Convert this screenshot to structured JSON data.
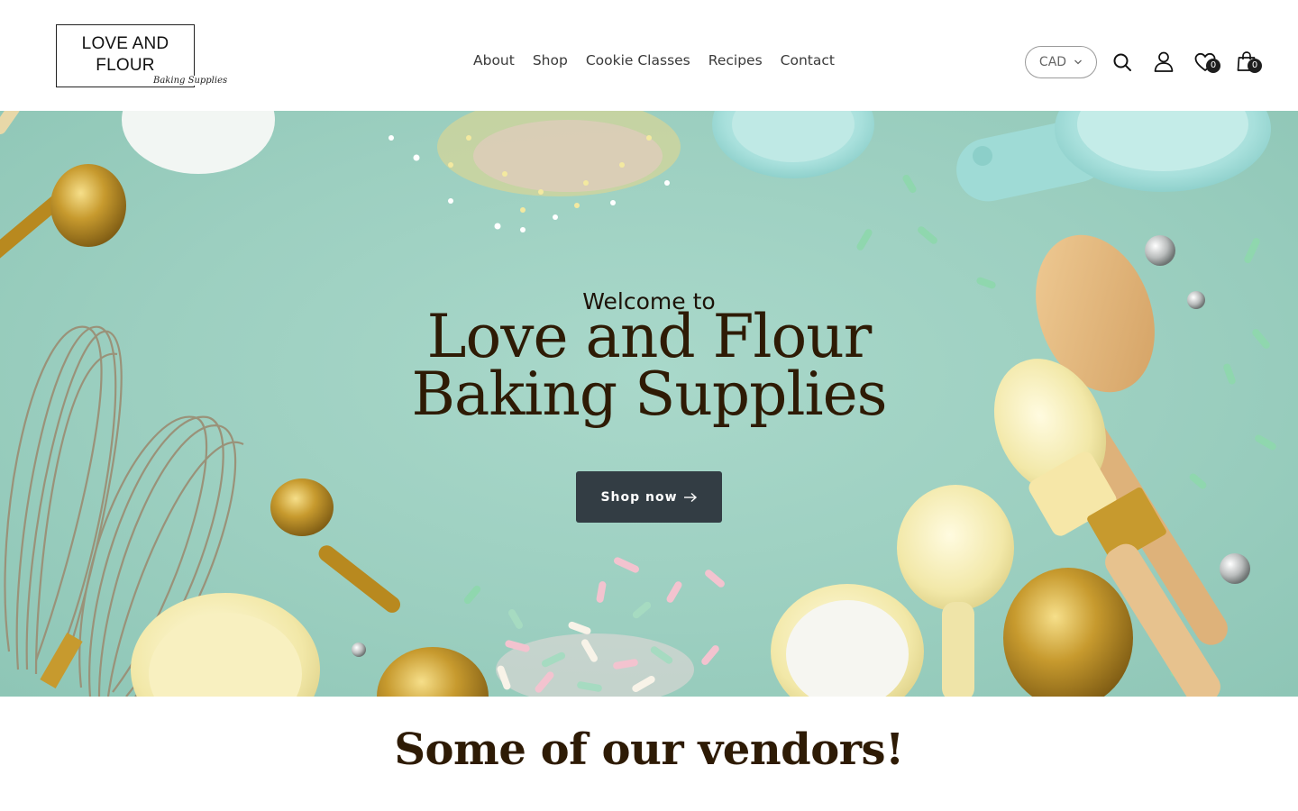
{
  "header": {
    "logo": {
      "line1": "LOVE AND",
      "line2": "FLOUR",
      "script": "Baking Supplies"
    },
    "nav": [
      {
        "label": "About"
      },
      {
        "label": "Shop"
      },
      {
        "label": "Cookie Classes"
      },
      {
        "label": "Recipes"
      },
      {
        "label": "Contact"
      }
    ],
    "currency": {
      "selected": "CAD",
      "icon": "chevron-down-icon"
    },
    "icons": [
      {
        "name": "search-icon"
      },
      {
        "name": "account-icon"
      },
      {
        "name": "wishlist-icon",
        "count": "0"
      },
      {
        "name": "cart-icon",
        "count": "0"
      }
    ]
  },
  "hero": {
    "welcome": "Welcome to",
    "title_line1": "Love and Flour",
    "title_line2": "Baking Supplies",
    "button_label": "Shop now",
    "button_icon": "arrow-right-icon",
    "background_color": "#9ccfc0"
  },
  "vendors": {
    "title": "Some of our vendors!"
  },
  "colors": {
    "heading": "#2e1b05",
    "button_bg": "#333d44",
    "badge_bg": "#1e1e1e"
  }
}
